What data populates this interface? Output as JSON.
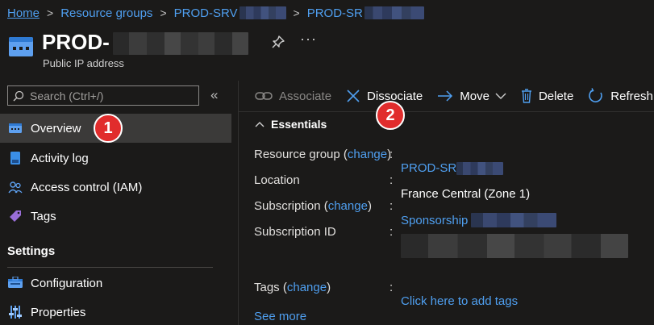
{
  "breadcrumb": {
    "home": "Home",
    "resource_groups": "Resource groups",
    "group": "PROD-SRV",
    "resource": "PROD-SR"
  },
  "header": {
    "title": "PROD-",
    "subtitle": "Public IP address",
    "more": "···"
  },
  "sidebar": {
    "search_placeholder": "Search (Ctrl+/)",
    "collapse": "«",
    "items": [
      {
        "label": "Overview"
      },
      {
        "label": "Activity log"
      },
      {
        "label": "Access control (IAM)"
      },
      {
        "label": "Tags"
      }
    ],
    "settings_header": "Settings",
    "settings_items": [
      {
        "label": "Configuration"
      },
      {
        "label": "Properties"
      }
    ]
  },
  "toolbar": {
    "associate": "Associate",
    "dissociate": "Dissociate",
    "move": "Move",
    "delete": "Delete",
    "refresh": "Refresh"
  },
  "essentials": {
    "title": "Essentials",
    "resource_group": {
      "label": "Resource group",
      "change": "change",
      "value": "PROD-SR"
    },
    "location": {
      "label": "Location",
      "value": "France Central (Zone 1)"
    },
    "subscription": {
      "label": "Subscription",
      "change": "change",
      "value": "Sponsorship"
    },
    "subscription_id": {
      "label": "Subscription ID"
    },
    "tags": {
      "label": "Tags",
      "change": "change",
      "value": "Click here to add tags"
    },
    "see_more": "See more"
  },
  "badges": {
    "one": "1",
    "two": "2"
  },
  "colors": {
    "accent": "#4f9ff0",
    "background": "#1b1a19",
    "badge": "#e12c2c",
    "active": "#3b3a39"
  }
}
